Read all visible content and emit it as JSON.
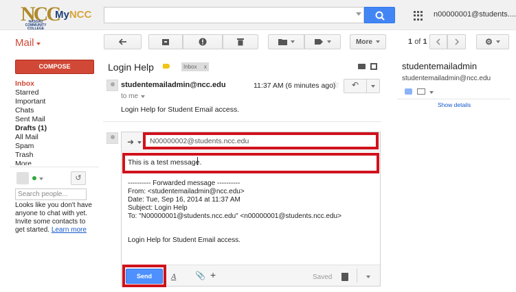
{
  "header": {
    "logo_text": "NCC",
    "logo_subtext": "NASSAU COMMUNITY COLLEGE",
    "brand_my": "My",
    "brand_ncc": "NCC",
    "search_value": "",
    "account": "n00000001@students...."
  },
  "toolbar": {
    "mail_label": "Mail",
    "more_label": "More",
    "pager_current": "1",
    "pager_of": "of",
    "pager_total": "1"
  },
  "sidebar": {
    "compose_label": "COMPOSE",
    "items": [
      {
        "label": "Inbox",
        "active": true
      },
      {
        "label": "Starred"
      },
      {
        "label": "Important"
      },
      {
        "label": "Chats"
      },
      {
        "label": "Sent Mail"
      },
      {
        "label": "Drafts (1)",
        "bold": true
      },
      {
        "label": "All Mail"
      },
      {
        "label": "Spam"
      },
      {
        "label": "Trash"
      },
      {
        "label": "More"
      }
    ],
    "search_people_placeholder": "Search people...",
    "chat_help": "Looks like you don't have anyone to chat with yet. Invite some contacts to get started.",
    "learn_more": "Learn more"
  },
  "thread": {
    "subject": "Login Help",
    "label_chip": "Inbox",
    "label_chip_close": "x"
  },
  "message": {
    "sender": "studentemailadmin@ncc.edu",
    "to_me": "to me",
    "time": "11:37 AM (6 minutes ago)",
    "snippet": "Login Help for Student Email access."
  },
  "compose": {
    "to_value": "N00000002@students.ncc.edu",
    "body_text": "This is a test message.",
    "forwarded": {
      "separator": "---------- Forwarded message ----------",
      "from": "From: <studentemailadmin@ncc.edu>",
      "date": "Date: Tue, Sep 16, 2014 at 11:37 AM",
      "subject": "Subject: Login Help",
      "to": "To: \"N00000001@students.ncc.edu\" <n00000001@students.ncc.edu>",
      "body": "Login Help for Student Email access."
    },
    "send_label": "Send",
    "saved_label": "Saved"
  },
  "contact": {
    "name": "studentemailadmin",
    "email": "studentemailadmin@ncc.edu",
    "show_details": "Show details"
  },
  "colors": {
    "accent_red": "#d14836",
    "send_blue": "#4d90fe",
    "search_blue": "#4285f4",
    "highlight_red": "#d0121c",
    "link_blue": "#1155cc"
  },
  "icons": [
    "search-icon",
    "apps-grid-icon",
    "back-arrow-icon",
    "archive-icon",
    "spam-icon",
    "delete-icon",
    "folder-icon",
    "label-icon",
    "chevron-left-icon",
    "chevron-right-icon",
    "gear-icon",
    "print-icon",
    "new-window-icon",
    "star-icon",
    "reply-icon",
    "forward-icon",
    "formatting-icon",
    "attach-icon",
    "plus-icon",
    "trash-icon"
  ]
}
